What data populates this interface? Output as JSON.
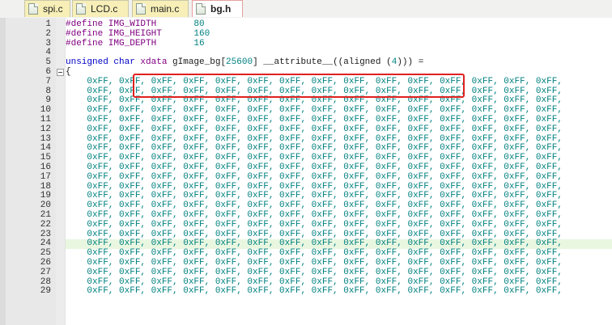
{
  "tabs": [
    {
      "label": "spi.c",
      "active": false
    },
    {
      "label": "LCD.c",
      "active": false
    },
    {
      "label": "main.c",
      "active": false
    },
    {
      "label": "bg.h",
      "active": true
    }
  ],
  "editor": {
    "lines": [
      {
        "n": "1",
        "parts": [
          {
            "t": "#define IMG_WIDTH ",
            "c": "pp"
          },
          {
            "t": "      80",
            "c": "num"
          }
        ]
      },
      {
        "n": "2",
        "parts": [
          {
            "t": "#define IMG_HEIGHT",
            "c": "pp"
          },
          {
            "t": "      160",
            "c": "num"
          }
        ]
      },
      {
        "n": "3",
        "parts": [
          {
            "t": "#define IMG_DEPTH ",
            "c": "pp"
          },
          {
            "t": "      16",
            "c": "num"
          }
        ]
      },
      {
        "n": "4",
        "parts": []
      },
      {
        "n": "5",
        "parts": [
          {
            "t": "unsigned char ",
            "c": "kw"
          },
          {
            "t": "xdata ",
            "c": "pp"
          },
          {
            "t": "gImage_bg[",
            "c": ""
          },
          {
            "t": "25600",
            "c": "num"
          },
          {
            "t": "] __attribute__((aligned (",
            "c": ""
          },
          {
            "t": "4",
            "c": "num"
          },
          {
            "t": "))) =",
            "c": ""
          }
        ]
      },
      {
        "n": "6",
        "parts": [
          {
            "t": "{",
            "c": ""
          }
        ],
        "fold": true
      },
      {
        "n": "7",
        "parts": [
          {
            "t": "    0xFF, 0xFF, 0xFF, 0xFF, 0xFF, 0xFF, 0xFF, 0xFF, 0xFF, 0xFF, 0xFF, 0xFF, 0xFF, 0xFF, 0xFF,",
            "c": "hexrow"
          }
        ]
      },
      {
        "n": "8",
        "parts": [
          {
            "t": "    0xFF, 0xFF, 0xFF, 0xFF, 0xFF, 0xFF, 0xFF, 0xFF, 0xFF, 0xFF, 0xFF, 0xFF, 0xFF, 0xFF, 0xFF,",
            "c": "hexrow"
          }
        ]
      },
      {
        "n": "9",
        "parts": [
          {
            "t": "    0xFF, 0xFF, 0xFF, 0xFF, 0xFF, 0xFF, 0xFF, 0xFF, 0xFF, 0xFF, 0xFF, 0xFF, 0xFF, 0xFF, 0xFF,",
            "c": "hexrow"
          }
        ]
      },
      {
        "n": "10",
        "parts": [
          {
            "t": "    0xFF, 0xFF, 0xFF, 0xFF, 0xFF, 0xFF, 0xFF, 0xFF, 0xFF, 0xFF, 0xFF, 0xFF, 0xFF, 0xFF, 0xFF,",
            "c": "hexrow"
          }
        ]
      },
      {
        "n": "11",
        "parts": [
          {
            "t": "    0xFF, 0xFF, 0xFF, 0xFF, 0xFF, 0xFF, 0xFF, 0xFF, 0xFF, 0xFF, 0xFF, 0xFF, 0xFF, 0xFF, 0xFF,",
            "c": "hexrow"
          }
        ]
      },
      {
        "n": "12",
        "parts": [
          {
            "t": "    0xFF, 0xFF, 0xFF, 0xFF, 0xFF, 0xFF, 0xFF, 0xFF, 0xFF, 0xFF, 0xFF, 0xFF, 0xFF, 0xFF, 0xFF,",
            "c": "hexrow"
          }
        ]
      },
      {
        "n": "13",
        "parts": [
          {
            "t": "    0xFF, 0xFF, 0xFF, 0xFF, 0xFF, 0xFF, 0xFF, 0xFF, 0xFF, 0xFF, 0xFF, 0xFF, 0xFF, 0xFF, 0xFF,",
            "c": "hexrow"
          }
        ]
      },
      {
        "n": "14",
        "parts": [
          {
            "t": "    0xFF, 0xFF, 0xFF, 0xFF, 0xFF, 0xFF, 0xFF, 0xFF, 0xFF, 0xFF, 0xFF, 0xFF, 0xFF, 0xFF, 0xFF,",
            "c": "hexrow"
          }
        ]
      },
      {
        "n": "15",
        "parts": [
          {
            "t": "    0xFF, 0xFF, 0xFF, 0xFF, 0xFF, 0xFF, 0xFF, 0xFF, 0xFF, 0xFF, 0xFF, 0xFF, 0xFF, 0xFF, 0xFF,",
            "c": "hexrow"
          }
        ]
      },
      {
        "n": "16",
        "parts": [
          {
            "t": "    0xFF, 0xFF, 0xFF, 0xFF, 0xFF, 0xFF, 0xFF, 0xFF, 0xFF, 0xFF, 0xFF, 0xFF, 0xFF, 0xFF, 0xFF,",
            "c": "hexrow"
          }
        ]
      },
      {
        "n": "17",
        "parts": [
          {
            "t": "    0xFF, 0xFF, 0xFF, 0xFF, 0xFF, 0xFF, 0xFF, 0xFF, 0xFF, 0xFF, 0xFF, 0xFF, 0xFF, 0xFF, 0xFF,",
            "c": "hexrow"
          }
        ]
      },
      {
        "n": "18",
        "parts": [
          {
            "t": "    0xFF, 0xFF, 0xFF, 0xFF, 0xFF, 0xFF, 0xFF, 0xFF, 0xFF, 0xFF, 0xFF, 0xFF, 0xFF, 0xFF, 0xFF,",
            "c": "hexrow"
          }
        ]
      },
      {
        "n": "19",
        "parts": [
          {
            "t": "    0xFF, 0xFF, 0xFF, 0xFF, 0xFF, 0xFF, 0xFF, 0xFF, 0xFF, 0xFF, 0xFF, 0xFF, 0xFF, 0xFF, 0xFF,",
            "c": "hexrow"
          }
        ]
      },
      {
        "n": "20",
        "parts": [
          {
            "t": "    0xFF, 0xFF, 0xFF, 0xFF, 0xFF, 0xFF, 0xFF, 0xFF, 0xFF, 0xFF, 0xFF, 0xFF, 0xFF, 0xFF, 0xFF,",
            "c": "hexrow"
          }
        ]
      },
      {
        "n": "21",
        "parts": [
          {
            "t": "    0xFF, 0xFF, 0xFF, 0xFF, 0xFF, 0xFF, 0xFF, 0xFF, 0xFF, 0xFF, 0xFF, 0xFF, 0xFF, 0xFF, 0xFF,",
            "c": "hexrow"
          }
        ]
      },
      {
        "n": "22",
        "parts": [
          {
            "t": "    0xFF, 0xFF, 0xFF, 0xFF, 0xFF, 0xFF, 0xFF, 0xFF, 0xFF, 0xFF, 0xFF, 0xFF, 0xFF, 0xFF, 0xFF,",
            "c": "hexrow"
          }
        ]
      },
      {
        "n": "23",
        "parts": [
          {
            "t": "    0xFF, 0xFF, 0xFF, 0xFF, 0xFF, 0xFF, 0xFF, 0xFF, 0xFF, 0xFF, 0xFF, 0xFF, 0xFF, 0xFF, 0xFF,",
            "c": "hexrow"
          }
        ]
      },
      {
        "n": "24",
        "parts": [
          {
            "t": "    0xFF, 0xFF, 0xFF, 0xFF, 0xFF, 0xFF, 0xFF, 0xFF, 0xFF, 0xFF, 0xFF, 0xFF, 0xFF, 0xFF, 0xFF,",
            "c": "hexrow"
          }
        ],
        "current": true
      },
      {
        "n": "25",
        "parts": [
          {
            "t": "    0xFF, 0xFF, 0xFF, 0xFF, 0xFF, 0xFF, 0xFF, 0xFF, 0xFF, 0xFF, 0xFF, 0xFF, 0xFF, 0xFF, 0xFF,",
            "c": "hexrow"
          }
        ]
      },
      {
        "n": "26",
        "parts": [
          {
            "t": "    0xFF, 0xFF, 0xFF, 0xFF, 0xFF, 0xFF, 0xFF, 0xFF, 0xFF, 0xFF, 0xFF, 0xFF, 0xFF, 0xFF, 0xFF,",
            "c": "hexrow"
          }
        ]
      },
      {
        "n": "27",
        "parts": [
          {
            "t": "    0xFF, 0xFF, 0xFF, 0xFF, 0xFF, 0xFF, 0xFF, 0xFF, 0xFF, 0xFF, 0xFF, 0xFF, 0xFF, 0xFF, 0xFF,",
            "c": "hexrow"
          }
        ]
      },
      {
        "n": "28",
        "parts": [
          {
            "t": "    0xFF, 0xFF, 0xFF, 0xFF, 0xFF, 0xFF, 0xFF, 0xFF, 0xFF, 0xFF, 0xFF, 0xFF, 0xFF, 0xFF, 0xFF,",
            "c": "hexrow"
          }
        ]
      },
      {
        "n": "29",
        "parts": [
          {
            "t": "    0xFF, 0xFF, 0xFF, 0xFF, 0xFF, 0xFF, 0xFF, 0xFF, 0xFF, 0xFF, 0xFF, 0xFF, 0xFF, 0xFF, 0xFF,",
            "c": "hexrow"
          }
        ]
      }
    ]
  },
  "colors": {
    "highlight_box": "#e02020",
    "current_line": "#e9f7e1",
    "preprocessor": "#800080",
    "keyword": "#0000c8",
    "number": "#008080"
  },
  "icons": {
    "tab_file": "file-icon"
  }
}
